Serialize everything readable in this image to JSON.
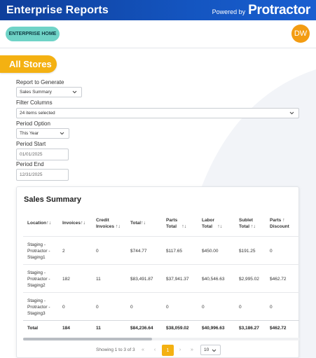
{
  "header": {
    "title": "Enterprise Reports",
    "powered_by": "Powered by",
    "brand": "Protractor",
    "home_button": "ENTERPRISE HOME",
    "avatar_initials": "DW"
  },
  "store_tab": "All Stores",
  "form": {
    "report_label": "Report to Generate",
    "report_value": "Sales Summary",
    "filter_label": "Filter Columns",
    "filter_value": "24 items selected",
    "period_label": "Period Option",
    "period_value": "This Year",
    "start_label": "Period Start",
    "start_value": "01/01/2025",
    "end_label": "Period End",
    "end_value": "12/31/2025"
  },
  "table": {
    "title": "Sales Summary",
    "columns": [
      {
        "line1": "Location",
        "line2": ""
      },
      {
        "line1": "Invoices",
        "line2": ""
      },
      {
        "line1": "Credit",
        "line2": "Invoices"
      },
      {
        "line1": "Total",
        "line2": ""
      },
      {
        "line1": "Parts",
        "line2": "Total"
      },
      {
        "line1": "Labor",
        "line2": "Total"
      },
      {
        "line1": "Sublet",
        "line2": "Total"
      },
      {
        "line1": "Parts",
        "line2": "Discount"
      }
    ],
    "sort_glyph": "↑↓",
    "rows": [
      {
        "loc": [
          "Staging -",
          "Protractor -",
          "Staging1"
        ],
        "cells": [
          "2",
          "0",
          "$744.77",
          "$117.65",
          "$450.00",
          "$191.25",
          "0"
        ]
      },
      {
        "loc": [
          "Staging -",
          "Protractor -",
          "Staging2"
        ],
        "cells": [
          "182",
          "11",
          "$83,491.87",
          "$37,941.37",
          "$40,546.63",
          "$2,995.02",
          "$462.72"
        ]
      },
      {
        "loc": [
          "Staging -",
          "Protractor -",
          "Staging3"
        ],
        "cells": [
          "0",
          "0",
          "0",
          "0",
          "0",
          "0",
          "0"
        ]
      }
    ],
    "total": {
      "label": "Total",
      "cells": [
        "184",
        "11",
        "$84,236.64",
        "$38,059.02",
        "$40,996.63",
        "$3,186.27",
        "$462.72"
      ]
    }
  },
  "pagination": {
    "showing": "Showing 1 to 3 of 3",
    "first": "«",
    "prev": "‹",
    "current": "1",
    "next": "›",
    "last": "»",
    "per_page": "10"
  },
  "colors": {
    "header_blue": "#1455c0",
    "accent_teal": "#6fd3c7",
    "accent_orange": "#f4b112",
    "avatar_orange": "#f39c12"
  }
}
